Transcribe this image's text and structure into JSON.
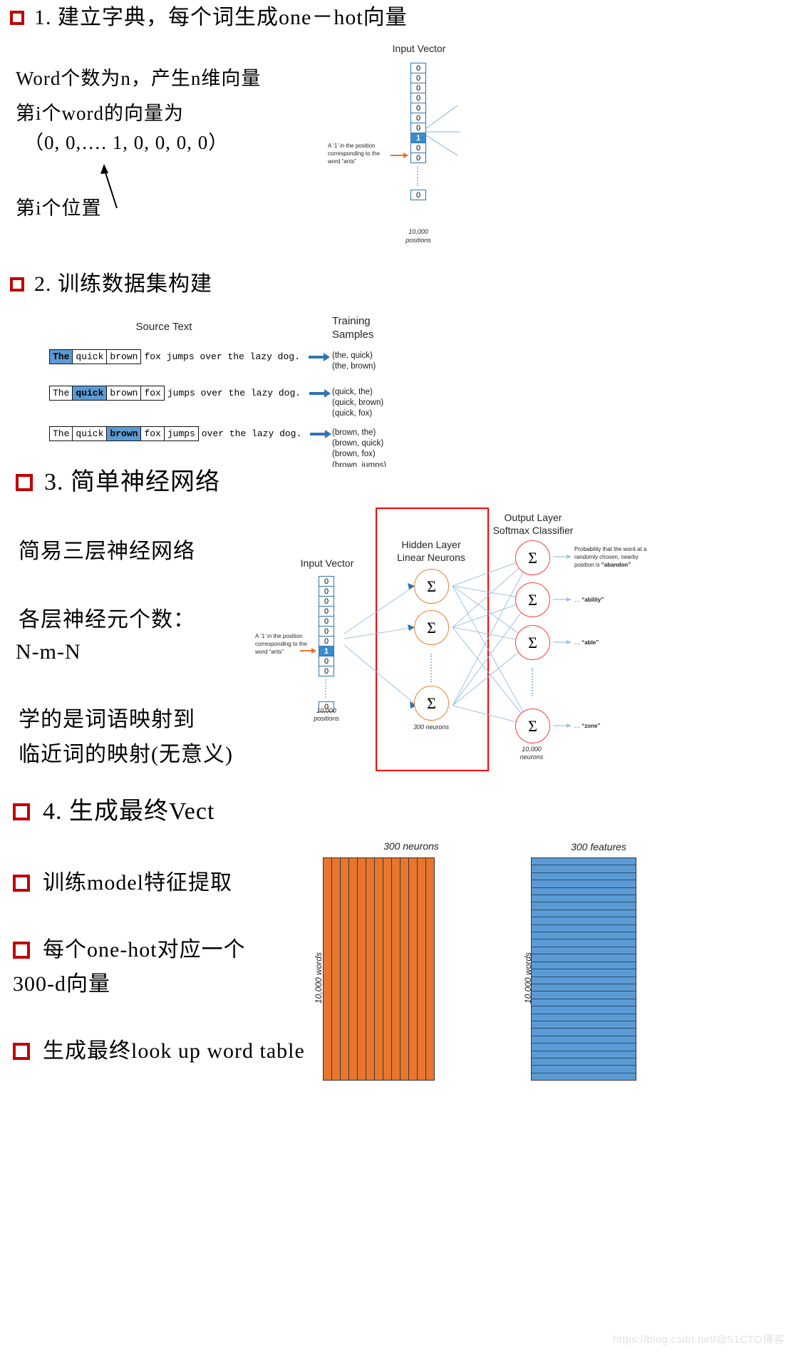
{
  "slide": {
    "sections": [
      {
        "id": "s1",
        "heading": "1. 建立字典，每个词生成one－hot向量",
        "lines": [
          "Word个数为n，产生n维向量",
          "第i个word的向量为",
          "（0, 0,…. 1, 0, 0, 0, 0）"
        ],
        "annotation": "第i个位置"
      },
      {
        "id": "s2",
        "heading": "2. 训练数据集构建"
      },
      {
        "id": "s3",
        "heading": "3. 简单神经网络",
        "lines": [
          "简易三层神经网络",
          "各层神经元个数：",
          "N-m-N",
          "学的是词语映射到",
          "临近词的映射(无意义)"
        ]
      },
      {
        "id": "s4",
        "heading": "4. 生成最终Vect",
        "bullets": [
          "训练model特征提取",
          "每个one-hot对应一个",
          "300-d向量",
          "生成最终look up word table"
        ]
      }
    ]
  },
  "input_vector": {
    "title": "Input Vector",
    "cells": [
      "0",
      "0",
      "0",
      "0",
      "0",
      "0",
      "0",
      "1",
      "0",
      "0"
    ],
    "hot_index": 7,
    "tail_cell": "0",
    "callout": "A ‘1’ in the position corresponding to the word “ants”",
    "callout_lines": [
      "A ‘1’ in the position",
      "corresponding to the",
      "word “ants”"
    ],
    "footer_lines": [
      "10,000",
      "positions"
    ]
  },
  "training": {
    "source_title": "Source Text",
    "samples_title_lines": [
      "Training",
      "Samples"
    ],
    "rows": [
      {
        "boxed": [
          {
            "w": "The",
            "hl": true
          },
          {
            "w": "quick",
            "hl": false
          },
          {
            "w": "brown",
            "hl": false
          }
        ],
        "rest": "fox jumps over the lazy dog."
      },
      {
        "boxed": [
          {
            "w": "The",
            "hl": false
          },
          {
            "w": "quick",
            "hl": true
          },
          {
            "w": "brown",
            "hl": false
          },
          {
            "w": "fox",
            "hl": false
          }
        ],
        "rest": "jumps over the lazy dog."
      },
      {
        "boxed": [
          {
            "w": "The",
            "hl": false
          },
          {
            "w": "quick",
            "hl": false
          },
          {
            "w": "brown",
            "hl": true
          },
          {
            "w": "fox",
            "hl": false
          },
          {
            "w": "jumps",
            "hl": false
          }
        ],
        "rest": "over the lazy dog."
      }
    ],
    "sample_groups": [
      [
        "(the, quick)",
        "(the, brown)"
      ],
      [
        "(quick, the)",
        "(quick, brown)",
        "(quick, fox)"
      ],
      [
        "(brown, the)",
        "(brown, quick)",
        "(brown, fox)",
        "(brown, jumps)"
      ]
    ]
  },
  "network": {
    "input_title": "Input Vector",
    "input_cells": [
      "0",
      "0",
      "0",
      "0",
      "0",
      "0",
      "0",
      "1",
      "0",
      "0"
    ],
    "input_hot_index": 7,
    "input_tail_cell": "0",
    "input_callout_lines": [
      "A ‘1’ in the position",
      "corresponding to the",
      "word “ants”"
    ],
    "input_footer_lines": [
      "10,000",
      "positions"
    ],
    "hidden_title_lines": [
      "Hidden Layer",
      "Linear Neurons"
    ],
    "hidden_footer": "300 neurons",
    "output_title_lines": [
      "Output Layer",
      "Softmax Classifier"
    ],
    "output_footer_lines": [
      "10,000",
      "neurons"
    ],
    "neuron_glyph": "Σ",
    "output_labels": [
      {
        "lines": [
          "Probability that the word at a",
          "randomly chosen, nearby",
          "position is "
        ],
        "bold": "“abandon”"
      },
      {
        "lines": [
          "… "
        ],
        "bold": "“ability”"
      },
      {
        "lines": [
          "… "
        ],
        "bold": "“able”"
      },
      {
        "lines": [
          "… "
        ],
        "bold": "“zone”"
      }
    ]
  },
  "matrices": {
    "left": {
      "top_label": "300   neurons",
      "side_label": "10,000   words",
      "color": "#E8762C",
      "stripes": 13,
      "orientation": "vertical"
    },
    "right": {
      "top_label": "300   features",
      "side_label": "10,000   words",
      "color": "#5B9BD5",
      "stripes": 30,
      "orientation": "horizontal"
    }
  },
  "watermark": "https://blog.csdn.net/@51CTO博客"
}
